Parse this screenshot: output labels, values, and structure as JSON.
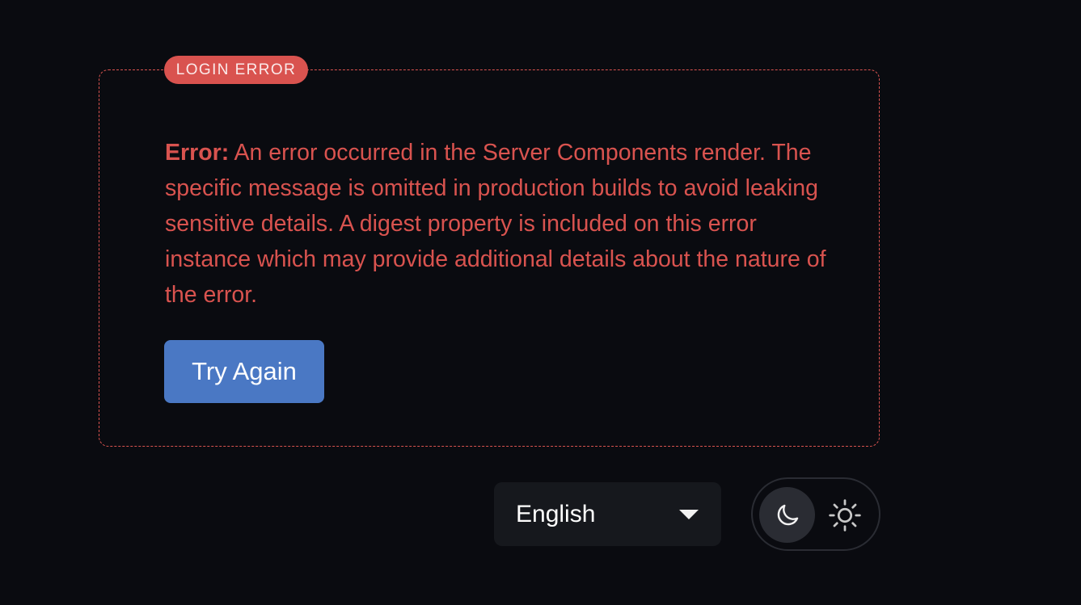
{
  "error_panel": {
    "badge_label": "LOGIN ERROR",
    "message_prefix": "Error:",
    "message_body": " An error occurred in the Server Components render. The specific message is omitted in production builds to avoid leaking sensitive details. A digest property is included on this error instance which may provide additional details about the nature of the error.",
    "retry_button_label": "Try Again"
  },
  "footer": {
    "language_select": {
      "selected": "English",
      "icon": "chevron-down-icon"
    },
    "theme_toggle": {
      "options": [
        {
          "name": "dark",
          "icon": "moon-icon",
          "active": true
        },
        {
          "name": "light",
          "icon": "sun-icon",
          "active": false
        }
      ]
    }
  },
  "colors": {
    "background": "#0a0b10",
    "error": "#d9534f",
    "primary_button": "#4a78c4",
    "select_background": "#16181d",
    "toggle_active": "#2a2c33"
  }
}
